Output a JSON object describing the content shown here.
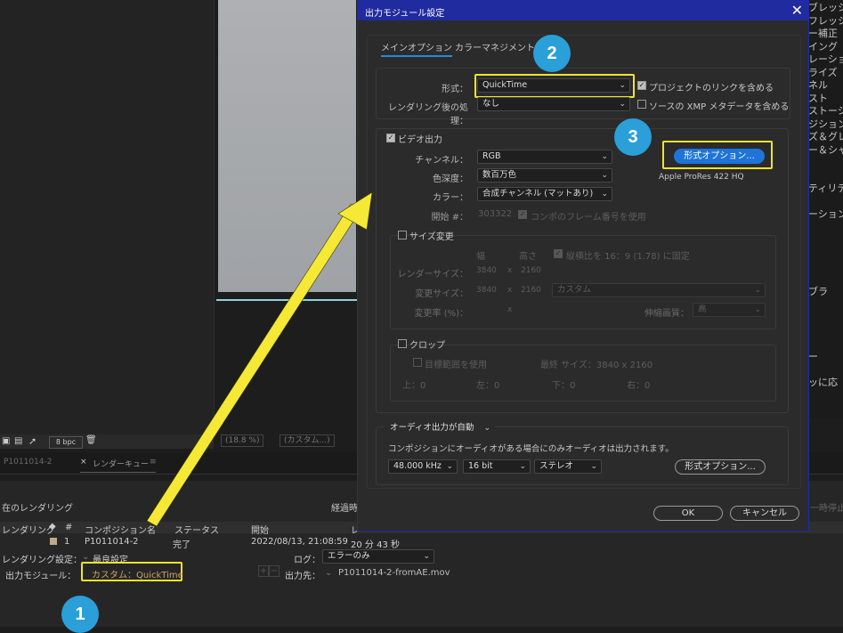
{
  "app": {
    "right_panel_items": [
      "ブレッシ",
      "フレッシ",
      "ー補正",
      "イング",
      "レーショ",
      "ライズ",
      "ネル",
      "スト",
      "ストーショ",
      "ジション",
      "ズ＆グレイ",
      "ー＆シャ",
      "",
      "",
      "ティリティ",
      "",
      "ーション",
      "",
      "",
      "",
      "",
      "",
      "ブラ",
      "",
      "",
      "",
      "",
      "ー",
      "",
      "ッに応"
    ],
    "viewer_toolbar": {
      "bpc": "8 bpc",
      "zoom": "(18.8 %)",
      "custom": "(カスタム...)"
    },
    "render_queue": {
      "tab_comp": "P1011014-2",
      "tab_close": "×",
      "tab_label": "レンダーキュー",
      "tab_menu": "≡",
      "current_render": "在のレンダリング",
      "elapsed_label": "経過時",
      "stop_label": "一時停止",
      "columns": [
        "レンダリング",
        "#",
        "コンポジション名",
        "ステータス",
        "開始",
        "レ"
      ],
      "row": {
        "num": "1",
        "comp": "P1011014-2",
        "status": "完了",
        "start": "2022/08/13, 21:08:59",
        "elapsed": "20 分 43 秒"
      },
      "render_settings_label": "レンダリング設定：",
      "render_settings_value": "最良設定",
      "log_label": "ログ：",
      "log_value": "エラーのみ",
      "output_module_label": "出力モジュール：",
      "output_module_value": "カスタム：QuickTime",
      "output_to_label": "出力先：",
      "output_to_value": "P1011014-2-fromAE.mov",
      "add_btn": "+",
      "remove_btn": "−"
    }
  },
  "dialog": {
    "title": "出力モジュール設定",
    "close": "✕",
    "tabs": [
      "メインオプション",
      "カラーマネジメント"
    ],
    "format_label": "形式：",
    "format_value": "QuickTime",
    "include_project_link": "プロジェクトのリンクを含める",
    "post_render_label": "レンダリング後の処理：",
    "post_render_value": "なし",
    "include_xmp": "ソースの XMP メタデータを含める",
    "video_output": "ビデオ出力",
    "channel_label": "チャンネル：",
    "channel_value": "RGB",
    "depth_label": "色深度：",
    "depth_value": "数百万色",
    "color_label": "カラー：",
    "color_value": "合成チャンネル (マットあり)",
    "start_label": "開始 #：",
    "start_value": "303322",
    "use_comp_frame": "コンポのフレーム番号を使用",
    "format_options_btn": "形式オプション...",
    "codec_text": "Apple ProRes 422 HQ",
    "resize": "サイズ変更",
    "width_hdr": "幅",
    "height_hdr": "高さ",
    "lock_aspect": "縦横比を 16：9 (1.78) に固定",
    "render_size_label": "レンダーサイズ：",
    "render_w": "3840",
    "render_x": "x",
    "render_h": "2160",
    "resize_to_label": "変更サイズ：",
    "resize_w": "3840",
    "resize_h": "2160",
    "resize_preset": "カスタム",
    "resize_pct_label": "変更率 (%)：",
    "resize_pct_x": "x",
    "quality_label": "伸縮画質：",
    "quality_value": "高",
    "crop": "クロップ",
    "use_roi": "目標範囲を使用",
    "final_size": "最終 サイズ：3840 x 2160",
    "crop_top": "上：0",
    "crop_left": "左：0",
    "crop_bottom": "下：0",
    "crop_right": "右：0",
    "audio_auto": "オーディオ出力が自動",
    "audio_note": "コンポジションにオーディオがある場合にのみオーディオは出力されます。",
    "sample_rate": "48.000 kHz",
    "bit_depth": "16 bit",
    "channels": "ステレオ",
    "audio_format_options": "形式オプション...",
    "ok": "OK",
    "cancel": "キャンセル"
  },
  "annotations": {
    "badge1": "1",
    "badge2": "2",
    "badge3": "3",
    "highlight_color": "#f1e52a",
    "badge_color": "#2a9fd8",
    "arrow_color": "#f5e836"
  }
}
